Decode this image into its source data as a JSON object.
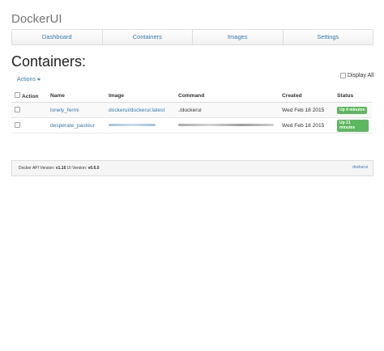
{
  "app": {
    "brand": "DockerUI"
  },
  "nav": {
    "tabs": [
      "Dashboard",
      "Containers",
      "Images",
      "Settings"
    ]
  },
  "page": {
    "title": "Containers:",
    "actions_label": "Actions",
    "display_all_label": "Display All"
  },
  "table": {
    "headers": [
      "Action",
      "Name",
      "Image",
      "Command",
      "Created",
      "Status"
    ],
    "rows": [
      {
        "name": "lonely_fermi",
        "image": "dockerui/dockerui:latest",
        "command": "./dockerui",
        "created": "Wed Feb 18 2015",
        "status": "Up 4 minutes"
      },
      {
        "name": "desperate_pasteur",
        "image": "",
        "command": "",
        "created": "Wed Feb 18 2015",
        "status": "Up 21 minutes"
      }
    ]
  },
  "footer": {
    "api_label": "Docker API Version:",
    "api_version": "v1.16",
    "ui_label": "UI Version:",
    "ui_version": "v0.6.0",
    "link": "dockerui"
  },
  "colors": {
    "link": "#337ab7",
    "status_badge": "#5cb85c"
  }
}
